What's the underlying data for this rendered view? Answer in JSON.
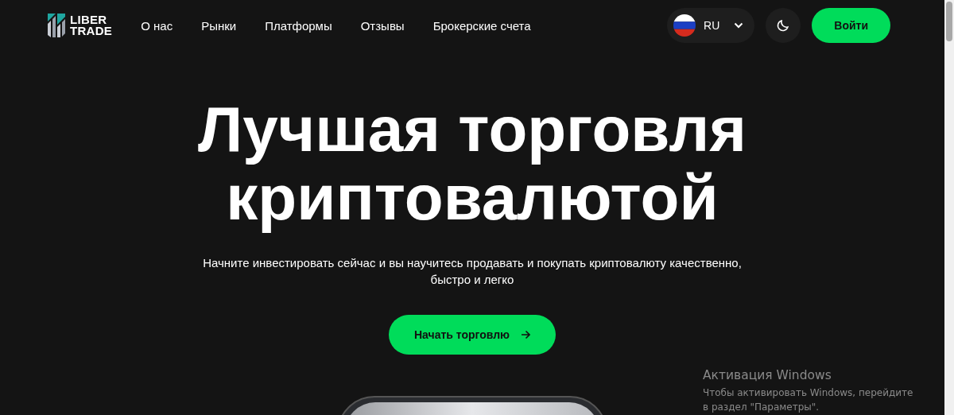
{
  "header": {
    "logo": {
      "line1": "LIBER",
      "line2": "TRADE"
    },
    "nav": [
      {
        "label": "О нас"
      },
      {
        "label": "Рынки"
      },
      {
        "label": "Платформы"
      },
      {
        "label": "Отзывы"
      },
      {
        "label": "Брокерские счета"
      }
    ],
    "language": {
      "code": "RU"
    },
    "login": "Войти"
  },
  "hero": {
    "title_lines": [
      "Лучшая торговля",
      "криптовалютой"
    ],
    "subtitle": "Начните инвестировать сейчас и вы научитесь продавать и покупать криптовалюту качественно, быстро и легко",
    "cta": "Начать торговлю"
  },
  "activation_notice": {
    "title": "Активация Windows",
    "text": "Чтобы активировать Windows, перейдите в раздел \"Параметры\"."
  }
}
